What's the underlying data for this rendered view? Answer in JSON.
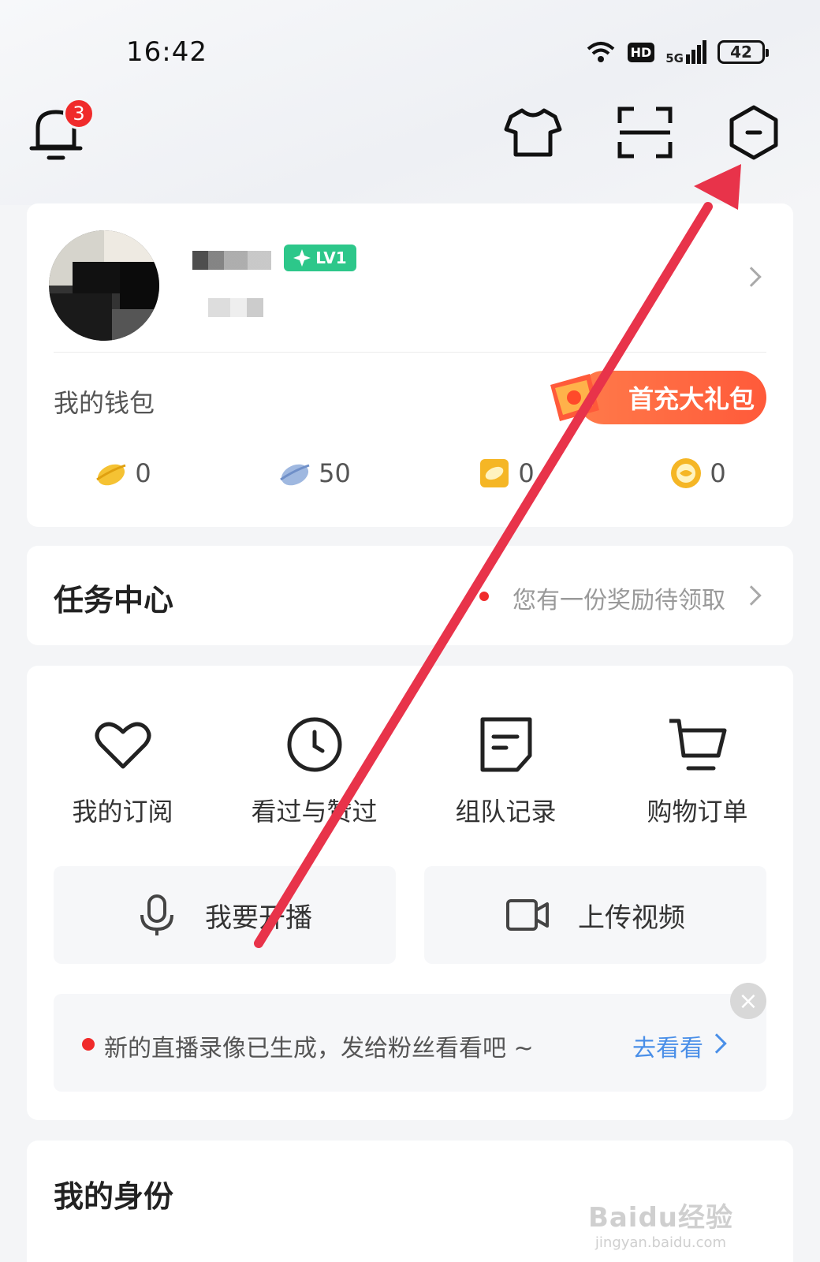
{
  "status_bar": {
    "time": "16:42",
    "battery": "42",
    "hd": "HD",
    "network": "5G"
  },
  "header": {
    "notification_count": "3"
  },
  "profile": {
    "level": "LV1"
  },
  "wallet": {
    "title": "我的钱包",
    "promo": "首充大礼包",
    "items": [
      {
        "icon": "gold-bean-icon",
        "value": "0"
      },
      {
        "icon": "silver-bean-icon",
        "value": "50"
      },
      {
        "icon": "coupon-icon",
        "value": "0"
      },
      {
        "icon": "coin-icon",
        "value": "0"
      }
    ]
  },
  "task_center": {
    "title": "任务中心",
    "tip": "您有一份奖励待领取"
  },
  "functions": [
    {
      "label": "我的订阅",
      "icon": "heart-icon"
    },
    {
      "label": "看过与赞过",
      "icon": "clock-icon"
    },
    {
      "label": "组队记录",
      "icon": "note-icon"
    },
    {
      "label": "购物订单",
      "icon": "cart-icon"
    }
  ],
  "actions": {
    "live": "我要开播",
    "upload": "上传视频"
  },
  "notice": {
    "text": "新的直播录像已生成，发给粉丝看看吧 ~",
    "link": "去看看"
  },
  "identity": {
    "title": "我的身份"
  },
  "watermark": {
    "logo": "Baidu经验",
    "url": "jingyan.baidu.com"
  },
  "colors": {
    "accent_red": "#e8334a",
    "promo_orange": "#ff6a3d",
    "link_blue": "#4a8fe8",
    "level_green": "#2dc78a"
  }
}
